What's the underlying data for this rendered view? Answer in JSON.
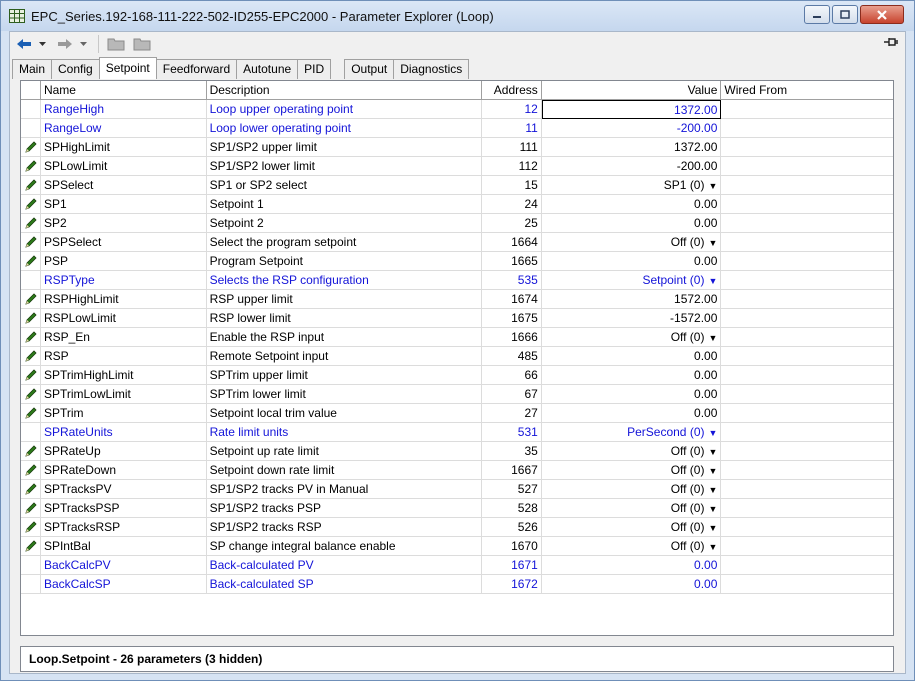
{
  "window": {
    "title": "EPC_Series.192-168-111-222-502-ID255-EPC2000 - Parameter Explorer (Loop)"
  },
  "tabs": [
    {
      "label": "Main"
    },
    {
      "label": "Config"
    },
    {
      "label": "Setpoint"
    },
    {
      "label": "Feedforward"
    },
    {
      "label": "Autotune"
    },
    {
      "label": "PID"
    },
    {
      "label": "Output"
    },
    {
      "label": "Diagnostics"
    }
  ],
  "active_tab": "Setpoint",
  "columns": {
    "name": "Name",
    "description": "Description",
    "address": "Address",
    "value": "Value",
    "wired_from": "Wired From"
  },
  "rows": [
    {
      "name": "RangeHigh",
      "description": "Loop upper operating point",
      "address": "12",
      "value": "1372.00",
      "editable": false,
      "dropdown": false,
      "selected": true
    },
    {
      "name": "RangeLow",
      "description": "Loop lower operating point",
      "address": "11",
      "value": "-200.00",
      "editable": false,
      "dropdown": false
    },
    {
      "name": "SPHighLimit",
      "description": "SP1/SP2 upper limit",
      "address": "111",
      "value": "1372.00",
      "editable": true,
      "dropdown": false
    },
    {
      "name": "SPLowLimit",
      "description": "SP1/SP2 lower limit",
      "address": "112",
      "value": "-200.00",
      "editable": true,
      "dropdown": false
    },
    {
      "name": "SPSelect",
      "description": "SP1 or SP2 select",
      "address": "15",
      "value": "SP1 (0)",
      "editable": true,
      "dropdown": true
    },
    {
      "name": "SP1",
      "description": "Setpoint 1",
      "address": "24",
      "value": "0.00",
      "editable": true,
      "dropdown": false
    },
    {
      "name": "SP2",
      "description": "Setpoint 2",
      "address": "25",
      "value": "0.00",
      "editable": true,
      "dropdown": false
    },
    {
      "name": "PSPSelect",
      "description": "Select the program setpoint",
      "address": "1664",
      "value": "Off (0)",
      "editable": true,
      "dropdown": true
    },
    {
      "name": "PSP",
      "description": "Program Setpoint",
      "address": "1665",
      "value": "0.00",
      "editable": true,
      "dropdown": false
    },
    {
      "name": "RSPType",
      "description": "Selects the RSP configuration",
      "address": "535",
      "value": "Setpoint (0)",
      "editable": false,
      "dropdown": true
    },
    {
      "name": "RSPHighLimit",
      "description": "RSP upper limit",
      "address": "1674",
      "value": "1572.00",
      "editable": true,
      "dropdown": false
    },
    {
      "name": "RSPLowLimit",
      "description": "RSP lower limit",
      "address": "1675",
      "value": "-1572.00",
      "editable": true,
      "dropdown": false
    },
    {
      "name": "RSP_En",
      "description": "Enable the RSP input",
      "address": "1666",
      "value": "Off (0)",
      "editable": true,
      "dropdown": true
    },
    {
      "name": "RSP",
      "description": "Remote Setpoint input",
      "address": "485",
      "value": "0.00",
      "editable": true,
      "dropdown": false
    },
    {
      "name": "SPTrimHighLimit",
      "description": "SPTrim upper limit",
      "address": "66",
      "value": "0.00",
      "editable": true,
      "dropdown": false
    },
    {
      "name": "SPTrimLowLimit",
      "description": "SPTrim lower limit",
      "address": "67",
      "value": "0.00",
      "editable": true,
      "dropdown": false
    },
    {
      "name": "SPTrim",
      "description": "Setpoint local trim value",
      "address": "27",
      "value": "0.00",
      "editable": true,
      "dropdown": false
    },
    {
      "name": "SPRateUnits",
      "description": "Rate limit units",
      "address": "531",
      "value": "PerSecond (0)",
      "editable": false,
      "dropdown": true
    },
    {
      "name": "SPRateUp",
      "description": "Setpoint up rate limit",
      "address": "35",
      "value": "Off (0)",
      "editable": true,
      "dropdown": true
    },
    {
      "name": "SPRateDown",
      "description": "Setpoint down rate limit",
      "address": "1667",
      "value": "Off (0)",
      "editable": true,
      "dropdown": true
    },
    {
      "name": "SPTracksPV",
      "description": "SP1/SP2 tracks PV in Manual",
      "address": "527",
      "value": "Off (0)",
      "editable": true,
      "dropdown": true
    },
    {
      "name": "SPTracksPSP",
      "description": "SP1/SP2 tracks PSP",
      "address": "528",
      "value": "Off (0)",
      "editable": true,
      "dropdown": true
    },
    {
      "name": "SPTracksRSP",
      "description": "SP1/SP2 tracks RSP",
      "address": "526",
      "value": "Off (0)",
      "editable": true,
      "dropdown": true
    },
    {
      "name": "SPIntBal",
      "description": "SP change integral balance enable",
      "address": "1670",
      "value": "Off (0)",
      "editable": true,
      "dropdown": true
    },
    {
      "name": "BackCalcPV",
      "description": "Back-calculated PV",
      "address": "1671",
      "value": "0.00",
      "editable": false,
      "dropdown": false
    },
    {
      "name": "BackCalcSP",
      "description": "Back-calculated SP",
      "address": "1672",
      "value": "0.00",
      "editable": false,
      "dropdown": false
    }
  ],
  "status": {
    "text": "Loop.Setpoint  -  26 parameters (3 hidden)"
  },
  "colors": {
    "readonly_text": "#1313d8",
    "editable_icon": "#2e7d1a"
  },
  "icons": {
    "back": "arrow-left-icon",
    "forward": "arrow-right-icon",
    "folder": "folder-icon",
    "pin": "pushpin-icon",
    "edit": "pencil-icon"
  }
}
